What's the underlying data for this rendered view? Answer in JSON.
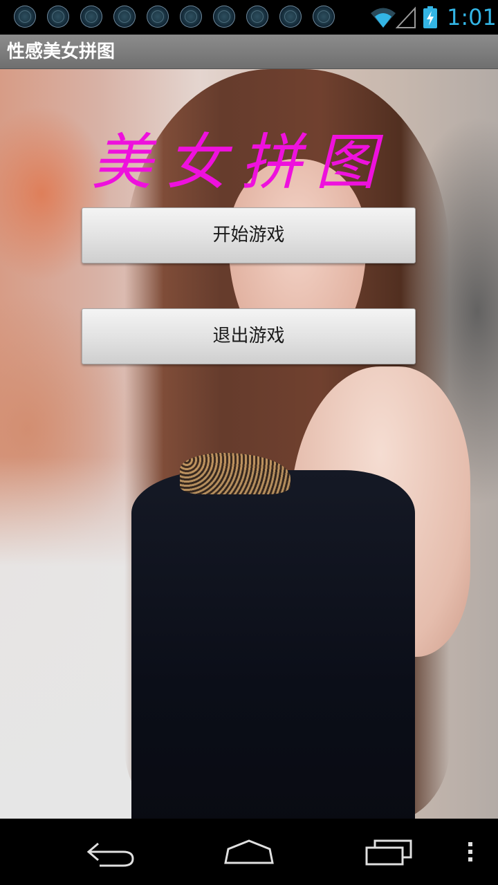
{
  "status_bar": {
    "time": "1:01",
    "notification_icons": [
      "app-notification-icon",
      "app-notification-icon",
      "app-notification-icon",
      "app-notification-icon",
      "app-notification-icon",
      "app-notification-icon",
      "app-notification-icon",
      "app-notification-icon",
      "app-notification-icon",
      "app-notification-icon"
    ],
    "wifi_icon": "wifi-icon",
    "signal_icon": "cell-signal-icon",
    "battery_icon": "battery-charging-icon",
    "clock_color": "#33b5e5"
  },
  "title_bar": {
    "title": "性感美女拼图"
  },
  "main": {
    "game_title": "美女拼图",
    "game_title_color": "#ee11dd",
    "start_button_label": "开始游戏",
    "exit_button_label": "退出游戏"
  },
  "nav_bar": {
    "back_icon": "back-icon",
    "home_icon": "home-icon",
    "recents_icon": "recent-apps-icon",
    "menu_icon": "overflow-menu-icon"
  }
}
